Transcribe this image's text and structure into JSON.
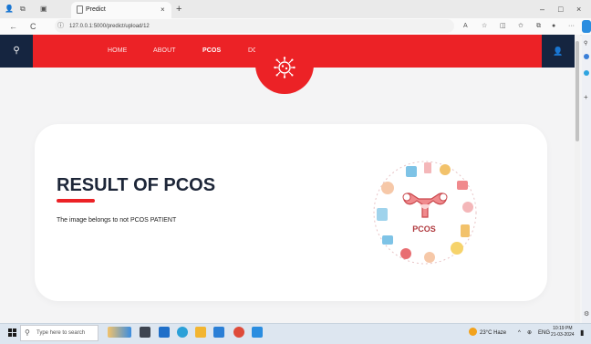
{
  "browser": {
    "tab_title": "Predict",
    "tab_close": "×",
    "new_tab": "+",
    "url": "127.0.0.1:5000/predict/upload/12",
    "minimize": "–",
    "maximize": "□",
    "close": "×",
    "back": "←",
    "reload": "C",
    "site_info": "ⓘ"
  },
  "site": {
    "search_icon": "search-icon",
    "nav": [
      {
        "label": "HOME",
        "active": false
      },
      {
        "label": "ABOUT",
        "active": false
      },
      {
        "label": "PCOS",
        "active": true
      },
      {
        "label": "DOCTORES",
        "active": false
      }
    ],
    "user_icon": "user-icon",
    "accent": "#ec2226",
    "dark": "#152540"
  },
  "result": {
    "title": "RESULT OF PCOS",
    "message": "The image belongs to not PCOS PATIENT",
    "illustration_label": "PCOS"
  },
  "taskbar": {
    "search_placeholder": "Type here to search",
    "weather": "23°C Haze",
    "lang": "ENG",
    "time": "10:19 PM",
    "date": "21-03-2024"
  }
}
